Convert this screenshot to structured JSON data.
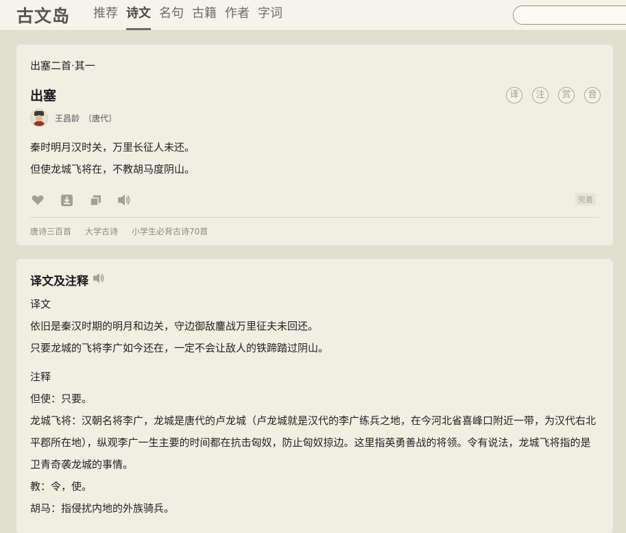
{
  "header": {
    "logo": "古文岛",
    "nav": [
      "推荐",
      "诗文",
      "名句",
      "古籍",
      "作者",
      "字词"
    ],
    "search_placeholder": ""
  },
  "poem_card": {
    "subtitle": "出塞二首·其一",
    "title": "出塞",
    "action_buttons": [
      "译",
      "注",
      "赏",
      "音"
    ],
    "author": "王昌龄",
    "dynasty": "〔唐代〕",
    "lines": [
      "秦时明月汉时关，万里长征人未还。",
      "但使龙城飞将在，不教胡马度阴山。"
    ],
    "tools": [
      "heart-icon",
      "download-icon",
      "copy-icon",
      "speaker-icon"
    ],
    "perfect_label": "完善",
    "tags": [
      "唐诗三百首",
      "大学古诗",
      "小学生必背古诗70首"
    ]
  },
  "translation_card": {
    "title": "译文及注释",
    "translation_heading": "译文",
    "translation_lines": [
      "依旧是秦汉时期的明月和边关，守边御敌鏖战万里征夫未回还。",
      "只要龙城的飞将李广如今还在，一定不会让敌人的铁蹄踏过阴山。"
    ],
    "notes_heading": "注释",
    "notes": [
      "但使：只要。",
      "龙城飞将：汉朝名将李广，龙城是唐代的卢龙城（卢龙城就是汉代的李广练兵之地，在今河北省喜峰口附近一带，为汉代右北平郡所在地），纵观李广一生主要的时间都在抗击匈奴，防止匈奴掠边。这里指英勇善战的将领。令有说法，龙城飞将指的是卫青奇袭龙城的事情。",
      "教：令，使。",
      "胡马：指侵扰内地的外族骑兵。"
    ]
  }
}
